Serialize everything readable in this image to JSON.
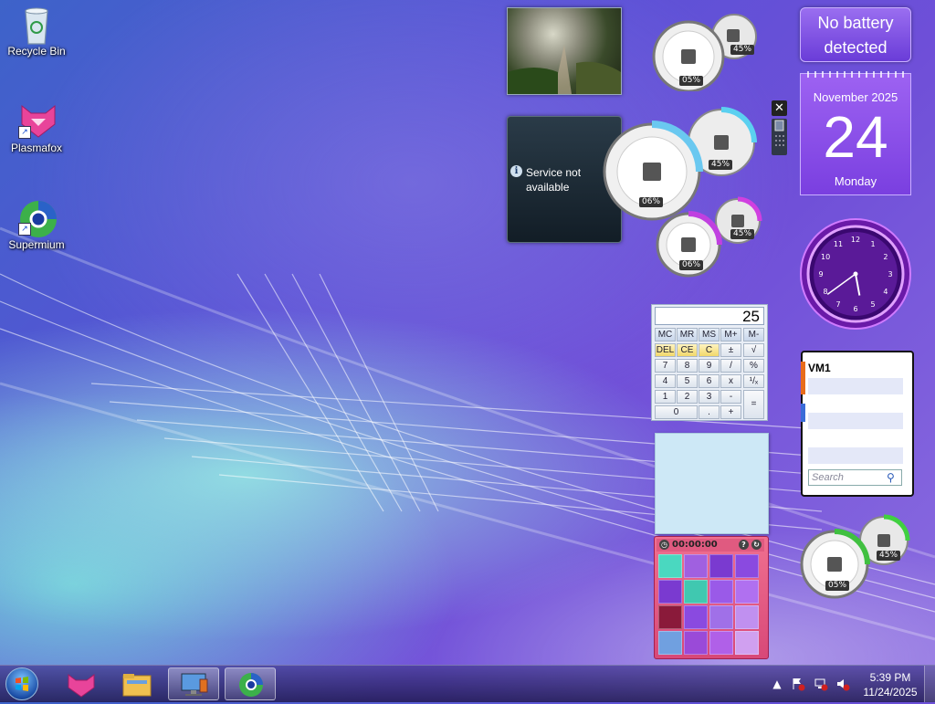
{
  "desktop": {
    "icons": [
      {
        "label": "Recycle Bin",
        "icon": "recycle-bin-icon"
      },
      {
        "label": "Plasmafox",
        "icon": "plasmafox-icon"
      },
      {
        "label": "Supermium",
        "icon": "supermium-icon"
      }
    ]
  },
  "gadgets": {
    "weather": {
      "message": "Service not available"
    },
    "cpu_meters": [
      {
        "cpu": "05%",
        "ram": "45%"
      },
      {
        "cpu": "06%",
        "ram": "45%"
      },
      {
        "cpu": "06%",
        "ram": "45%"
      },
      {
        "cpu": "05%",
        "ram": "45%"
      }
    ],
    "battery": {
      "line1": "No battery",
      "line2": "detected"
    },
    "calendar": {
      "month": "November 2025",
      "day": "24",
      "weekday": "Monday"
    },
    "clock": {
      "numbers": [
        "12",
        "1",
        "2",
        "3",
        "4",
        "5",
        "6",
        "7",
        "8",
        "9",
        "10",
        "11"
      ],
      "hour": 5,
      "minute": 39
    },
    "calculator": {
      "display": "25",
      "memory_row": [
        "MC",
        "MR",
        "MS",
        "M+",
        "M-"
      ],
      "row1": [
        "DEL",
        "CE",
        "C",
        "±",
        "√"
      ],
      "row2": [
        "7",
        "8",
        "9",
        "/",
        "%"
      ],
      "row3": [
        "4",
        "5",
        "6",
        "x",
        "¹/ₓ"
      ],
      "row4": [
        "1",
        "2",
        "3",
        "-"
      ],
      "row5": [
        "0",
        ".",
        "+"
      ],
      "equals": "="
    },
    "puzzle": {
      "timer": "00:00:00",
      "accent": "#d84878"
    },
    "feed": {
      "title": "VM1",
      "search_placeholder": "Search"
    },
    "controls": {
      "close": "✕"
    }
  },
  "taskbar": {
    "clock_time": "5:39 PM",
    "clock_date": "11/24/2025",
    "tray_arrow": "▲"
  }
}
